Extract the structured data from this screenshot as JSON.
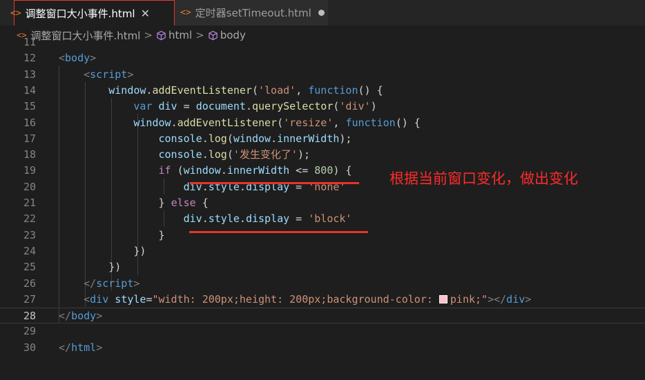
{
  "tabs": [
    {
      "icon": "<>",
      "label": "调整窗口大小事件.html",
      "close": "✕"
    },
    {
      "icon": "<>",
      "label": "定时器setTimeout.html"
    }
  ],
  "breadcrumb": {
    "file": "调整窗口大小事件.html",
    "sep": ">",
    "items": [
      "html",
      "body"
    ]
  },
  "editor": {
    "current_line": "28",
    "lines": [
      {
        "n": "11",
        "tokens": []
      },
      {
        "n": "12",
        "tokens": [
          [
            "br",
            "<"
          ],
          [
            "tag",
            "body"
          ],
          [
            "br",
            ">"
          ]
        ]
      },
      {
        "n": "13",
        "tokens": [
          [
            "pun",
            "    "
          ],
          [
            "br",
            "<"
          ],
          [
            "tag",
            "script"
          ],
          [
            "br",
            ">"
          ]
        ]
      },
      {
        "n": "14",
        "tokens": [
          [
            "pun",
            "        "
          ],
          [
            "var",
            "window"
          ],
          [
            "pun",
            "."
          ],
          [
            "fn",
            "addEventListener"
          ],
          [
            "pun",
            "("
          ],
          [
            "str",
            "'load'"
          ],
          [
            "pun",
            ", "
          ],
          [
            "kw",
            "function"
          ],
          [
            "pun",
            "() {"
          ]
        ]
      },
      {
        "n": "15",
        "tokens": [
          [
            "pun",
            "            "
          ],
          [
            "kw",
            "var"
          ],
          [
            "pun",
            " "
          ],
          [
            "var",
            "div"
          ],
          [
            "pun",
            " = "
          ],
          [
            "var",
            "document"
          ],
          [
            "pun",
            "."
          ],
          [
            "fn",
            "querySelector"
          ],
          [
            "pun",
            "("
          ],
          [
            "str",
            "'div'"
          ],
          [
            "pun",
            ")"
          ]
        ]
      },
      {
        "n": "16",
        "tokens": [
          [
            "pun",
            "            "
          ],
          [
            "var",
            "window"
          ],
          [
            "pun",
            "."
          ],
          [
            "fn",
            "addEventListener"
          ],
          [
            "pun",
            "("
          ],
          [
            "str",
            "'resize'"
          ],
          [
            "pun",
            ", "
          ],
          [
            "kw",
            "function"
          ],
          [
            "pun",
            "() {"
          ]
        ]
      },
      {
        "n": "17",
        "tokens": [
          [
            "pun",
            "                "
          ],
          [
            "var",
            "console"
          ],
          [
            "pun",
            "."
          ],
          [
            "fn",
            "log"
          ],
          [
            "pun",
            "("
          ],
          [
            "var",
            "window"
          ],
          [
            "pun",
            "."
          ],
          [
            "var",
            "innerWidth"
          ],
          [
            "pun",
            ");"
          ]
        ]
      },
      {
        "n": "18",
        "tokens": [
          [
            "pun",
            "                "
          ],
          [
            "var",
            "console"
          ],
          [
            "pun",
            "."
          ],
          [
            "fn",
            "log"
          ],
          [
            "pun",
            "("
          ],
          [
            "str",
            "'发生变化了'"
          ],
          [
            "pun",
            ");"
          ]
        ]
      },
      {
        "n": "19",
        "tokens": [
          [
            "pun",
            "                "
          ],
          [
            "ctl",
            "if"
          ],
          [
            "pun",
            " ("
          ],
          [
            "var",
            "window"
          ],
          [
            "pun",
            "."
          ],
          [
            "var",
            "innerWidth"
          ],
          [
            "pun",
            " <= "
          ],
          [
            "num",
            "800"
          ],
          [
            "pun",
            ") {"
          ]
        ]
      },
      {
        "n": "20",
        "tokens": [
          [
            "pun",
            "                    "
          ],
          [
            "var",
            "div"
          ],
          [
            "pun",
            "."
          ],
          [
            "var",
            "style"
          ],
          [
            "pun",
            "."
          ],
          [
            "var",
            "display"
          ],
          [
            "pun",
            " = "
          ],
          [
            "str",
            "'none'"
          ]
        ]
      },
      {
        "n": "21",
        "tokens": [
          [
            "pun",
            "                } "
          ],
          [
            "ctl",
            "else"
          ],
          [
            "pun",
            " {"
          ]
        ]
      },
      {
        "n": "22",
        "tokens": [
          [
            "pun",
            "                    "
          ],
          [
            "var",
            "div"
          ],
          [
            "pun",
            "."
          ],
          [
            "var",
            "style"
          ],
          [
            "pun",
            "."
          ],
          [
            "var",
            "display"
          ],
          [
            "pun",
            " = "
          ],
          [
            "str",
            "'block'"
          ]
        ]
      },
      {
        "n": "23",
        "tokens": [
          [
            "pun",
            "                }"
          ]
        ]
      },
      {
        "n": "24",
        "tokens": [
          [
            "pun",
            "            })"
          ]
        ]
      },
      {
        "n": "25",
        "tokens": [
          [
            "pun",
            "        })"
          ]
        ]
      },
      {
        "n": "26",
        "tokens": [
          [
            "pun",
            "    "
          ],
          [
            "br",
            "</"
          ],
          [
            "tag",
            "script"
          ],
          [
            "br",
            ">"
          ]
        ]
      },
      {
        "n": "27",
        "tokens": [
          [
            "pun",
            "    "
          ],
          [
            "br",
            "<"
          ],
          [
            "tag",
            "div"
          ],
          [
            "pun",
            " "
          ],
          [
            "attr",
            "style"
          ],
          [
            "pun",
            "="
          ],
          [
            "str",
            "\"width: 200px;height: 200px;background-color: "
          ],
          [
            "swatch",
            ""
          ],
          [
            "str",
            "pink;\""
          ],
          [
            "br",
            "></"
          ],
          [
            "tag",
            "div"
          ],
          [
            "br",
            ">"
          ]
        ]
      },
      {
        "n": "28",
        "tokens": [
          [
            "br",
            "</"
          ],
          [
            "tag",
            "body"
          ],
          [
            "br",
            ">"
          ]
        ]
      },
      {
        "n": "29",
        "tokens": []
      },
      {
        "n": "30",
        "tokens": [
          [
            "br",
            "</"
          ],
          [
            "tag",
            "html"
          ],
          [
            "br",
            ">"
          ]
        ]
      }
    ]
  },
  "annotation": "根据当前窗口变化，做出变化",
  "colors": {
    "accent_red": "#e8342a",
    "annotation_red": "#ff2a2a",
    "swatch_pink": "#ffc0cb"
  }
}
